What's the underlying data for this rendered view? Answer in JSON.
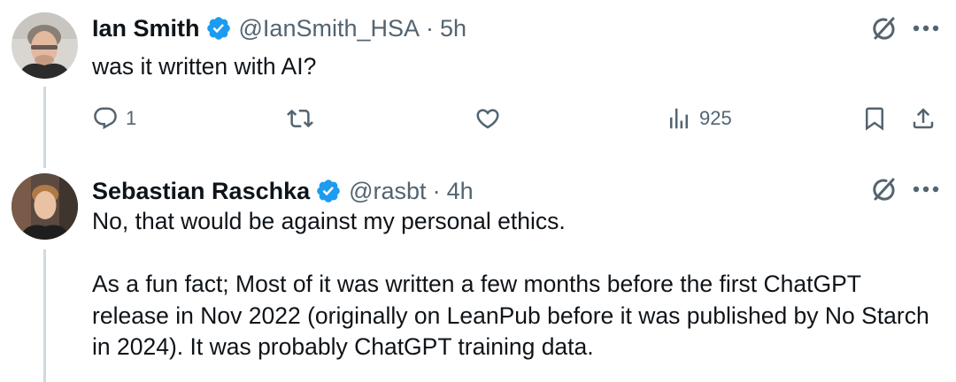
{
  "tweets": [
    {
      "author": {
        "name": "Ian Smith",
        "handle": "@IanSmith_HSA",
        "verified": true
      },
      "separator": "·",
      "time": "5h",
      "text": [
        "was it written with AI?"
      ],
      "actions": {
        "replies": "1",
        "views": "925"
      }
    },
    {
      "author": {
        "name": "Sebastian Raschka",
        "handle": "@rasbt",
        "verified": true
      },
      "separator": "·",
      "time": "4h",
      "text": [
        "No, that would be against my personal ethics.",
        "As a fun fact; Most of it was written a few months before the first ChatGPT release in Nov 2022 (originally on LeanPub before it was published by No Starch in 2024). It was probably ChatGPT training data."
      ]
    }
  ],
  "icons": {
    "verified": "verified-badge-icon",
    "grok": "grok-icon",
    "more": "more-icon",
    "reply": "reply-icon",
    "retweet": "retweet-icon",
    "like": "like-icon",
    "views": "views-icon",
    "bookmark": "bookmark-icon",
    "share": "share-icon"
  },
  "colors": {
    "text": "#0f1419",
    "secondary": "#536471",
    "verified": "#1d9bf0",
    "thread_line": "#cfd9de",
    "background": "#ffffff"
  }
}
